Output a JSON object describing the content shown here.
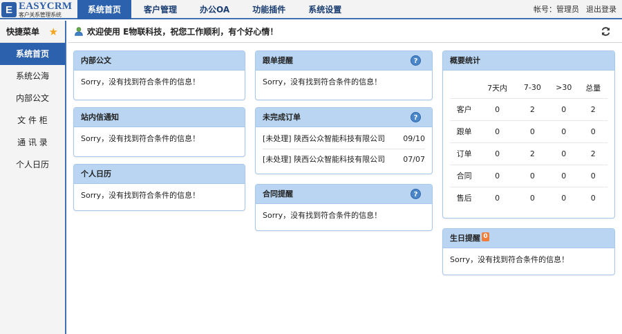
{
  "logo": {
    "mark": "E",
    "title": "EASYCRM",
    "subtitle": "客户关系管理系统"
  },
  "nav": {
    "items": [
      "系统首页",
      "客户管理",
      "办公OA",
      "功能插件",
      "系统设置"
    ]
  },
  "top_right": {
    "account": "帐号：管理员",
    "logout": "退出登录"
  },
  "sidebar": {
    "title": "快捷菜单",
    "items": [
      "系统首页",
      "系统公海",
      "内部公文",
      "文 件 柜",
      "通 讯 录",
      "个人日历"
    ]
  },
  "welcome": {
    "text": "欢迎使用 E物联科技，祝您工作顺利，有个好心情！"
  },
  "empty_text": "Sorry，没有找到符合条件的信息！",
  "panels": {
    "internal_doc": {
      "title": "内部公文"
    },
    "inbox_notice": {
      "title": "站内信通知"
    },
    "calendar": {
      "title": "个人日历"
    },
    "followup": {
      "title": "跟单提醒"
    },
    "orders": {
      "title": "未完成订单",
      "rows": [
        {
          "name": "[未处理] 陕西公众智能科技有限公司",
          "date": "09/10"
        },
        {
          "name": "[未处理] 陕西公众智能科技有限公司",
          "date": "07/07"
        }
      ]
    },
    "contract": {
      "title": "合同提醒"
    },
    "stats": {
      "title": "概要统计",
      "headers": [
        "",
        "7天内",
        "7-30",
        ">30",
        "总量"
      ],
      "rows": [
        [
          "客户",
          "0",
          "2",
          "0",
          "2"
        ],
        [
          "跟单",
          "0",
          "0",
          "0",
          "0"
        ],
        [
          "订单",
          "0",
          "2",
          "0",
          "2"
        ],
        [
          "合同",
          "0",
          "0",
          "0",
          "0"
        ],
        [
          "售后",
          "0",
          "0",
          "0",
          "0"
        ]
      ]
    },
    "birthday": {
      "title": "生日提醒",
      "badge": "0"
    }
  },
  "colors": {
    "nav_active": "#2c62ad",
    "panel_header": "#b9d5f1",
    "panel_border": "#a6c8ea",
    "badge": "#f07d3a",
    "star": "#f2a51c"
  }
}
